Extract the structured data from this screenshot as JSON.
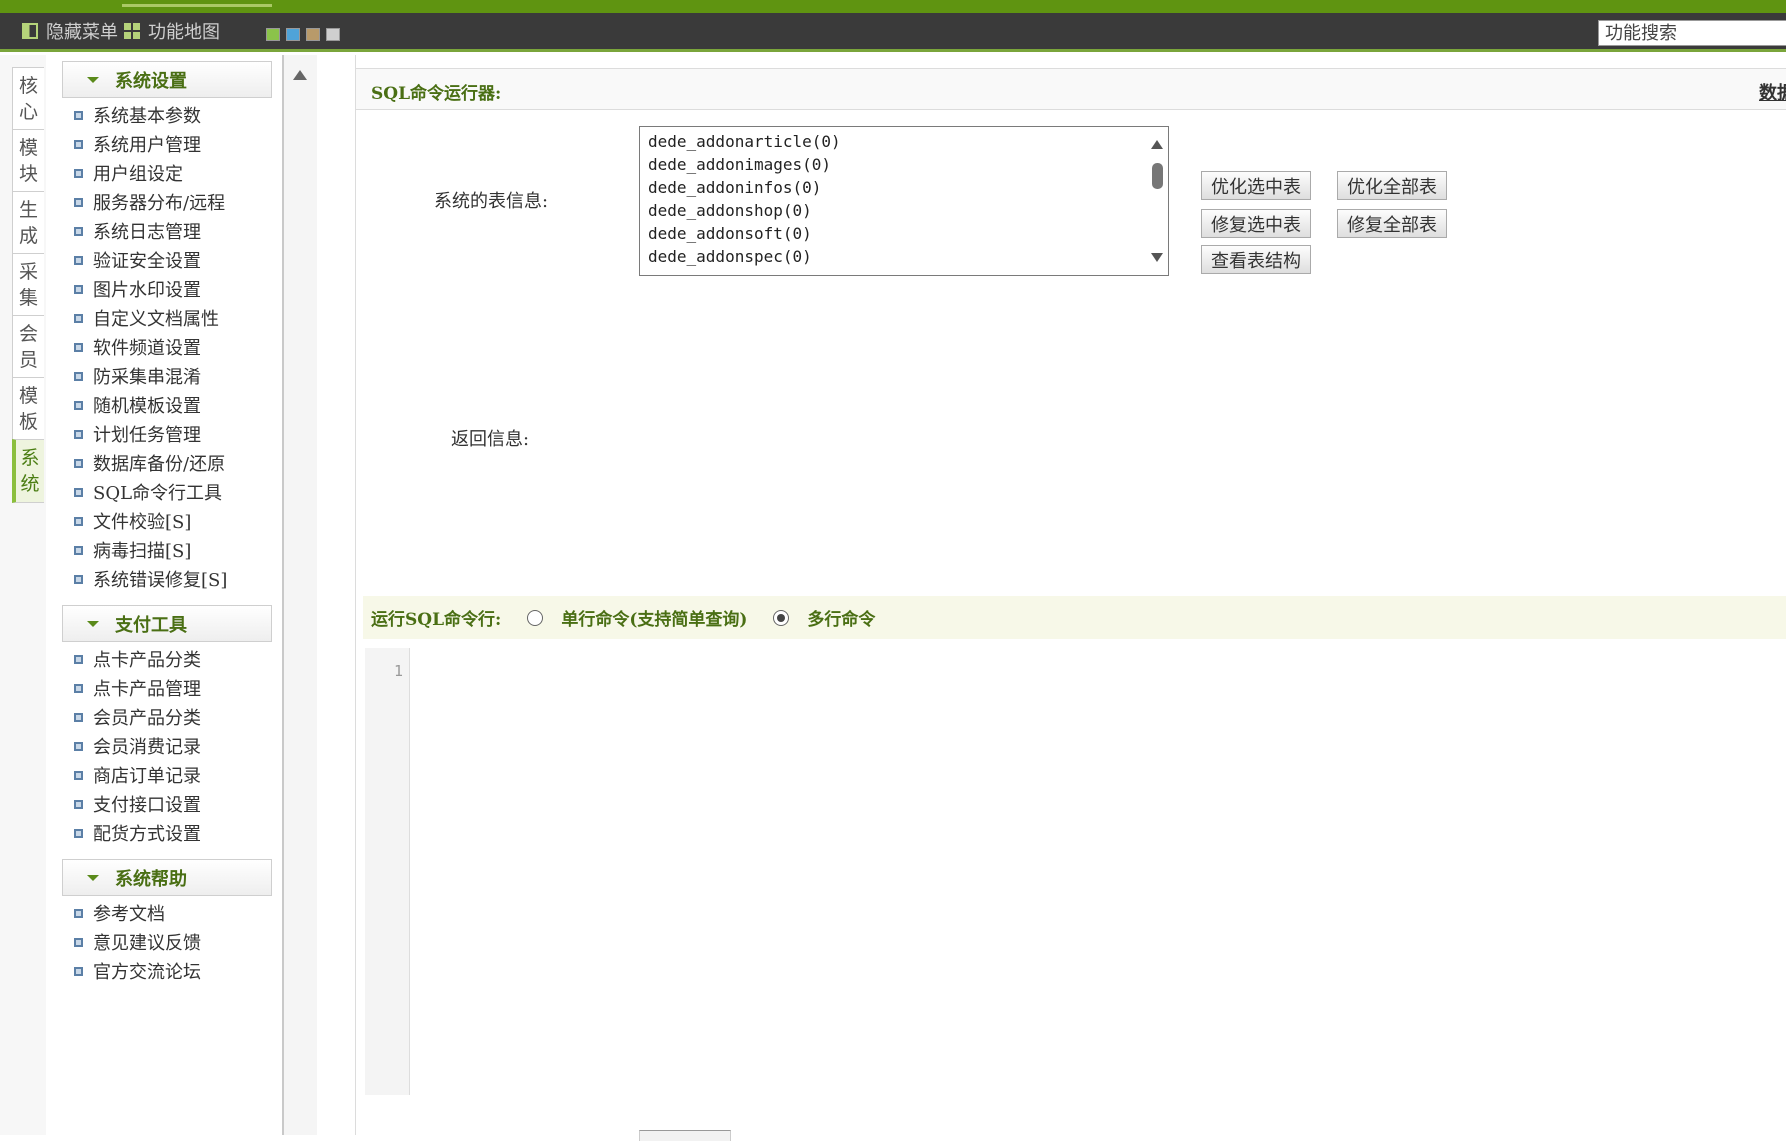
{
  "toolbar": {
    "hide_menu": "隐藏菜单",
    "function_map": "功能地图",
    "search_placeholder": "功能搜索",
    "swatches": [
      "#8bc34a",
      "#4fa3d8",
      "#b89a6a",
      "#cfcfcf"
    ]
  },
  "vtabs": [
    {
      "label": "核心",
      "active": false
    },
    {
      "label": "模块",
      "active": false
    },
    {
      "label": "生成",
      "active": false
    },
    {
      "label": "采集",
      "active": false
    },
    {
      "label": "会员",
      "active": false
    },
    {
      "label": "模板",
      "active": false
    },
    {
      "label": "系统",
      "active": true
    }
  ],
  "sidebar": {
    "sections": [
      {
        "title": "系统设置",
        "items": [
          "系统基本参数",
          "系统用户管理",
          "用户组设定",
          "服务器分布/远程",
          "系统日志管理",
          "验证安全设置",
          "图片水印设置",
          "自定义文档属性",
          "软件频道设置",
          "防采集串混淆",
          "随机模板设置",
          "计划任务管理",
          "数据库备份/还原",
          "SQL命令行工具",
          "文件校验[S]",
          "病毒扫描[S]",
          "系统错误修复[S]"
        ]
      },
      {
        "title": "支付工具",
        "items": [
          "点卡产品分类",
          "点卡产品管理",
          "会员产品分类",
          "会员消费记录",
          "商店订单记录",
          "支付接口设置",
          "配货方式设置"
        ]
      },
      {
        "title": "系统帮助",
        "items": [
          "参考文档",
          "意见建议反馈",
          "官方交流论坛"
        ]
      }
    ]
  },
  "main": {
    "title": "SQL命令运行器:",
    "right_link": "数据",
    "table_info_label": "系统的表信息:",
    "tables": [
      "dede_addonarticle(0)",
      "dede_addonimages(0)",
      "dede_addoninfos(0)",
      "dede_addonshop(0)",
      "dede_addonsoft(0)",
      "dede_addonspec(0)"
    ],
    "buttons": {
      "optimize_selected": "优化选中表",
      "optimize_all": "优化全部表",
      "repair_selected": "修复选中表",
      "repair_all": "修复全部表",
      "view_structure": "查看表结构"
    },
    "return_info_label": "返回信息:",
    "sql_bar": {
      "label": "运行SQL命令行:",
      "single": "单行命令(支持简单查询)",
      "multi": "多行命令",
      "selected": "multi"
    },
    "editor": {
      "line_number": "1",
      "content": ""
    }
  }
}
